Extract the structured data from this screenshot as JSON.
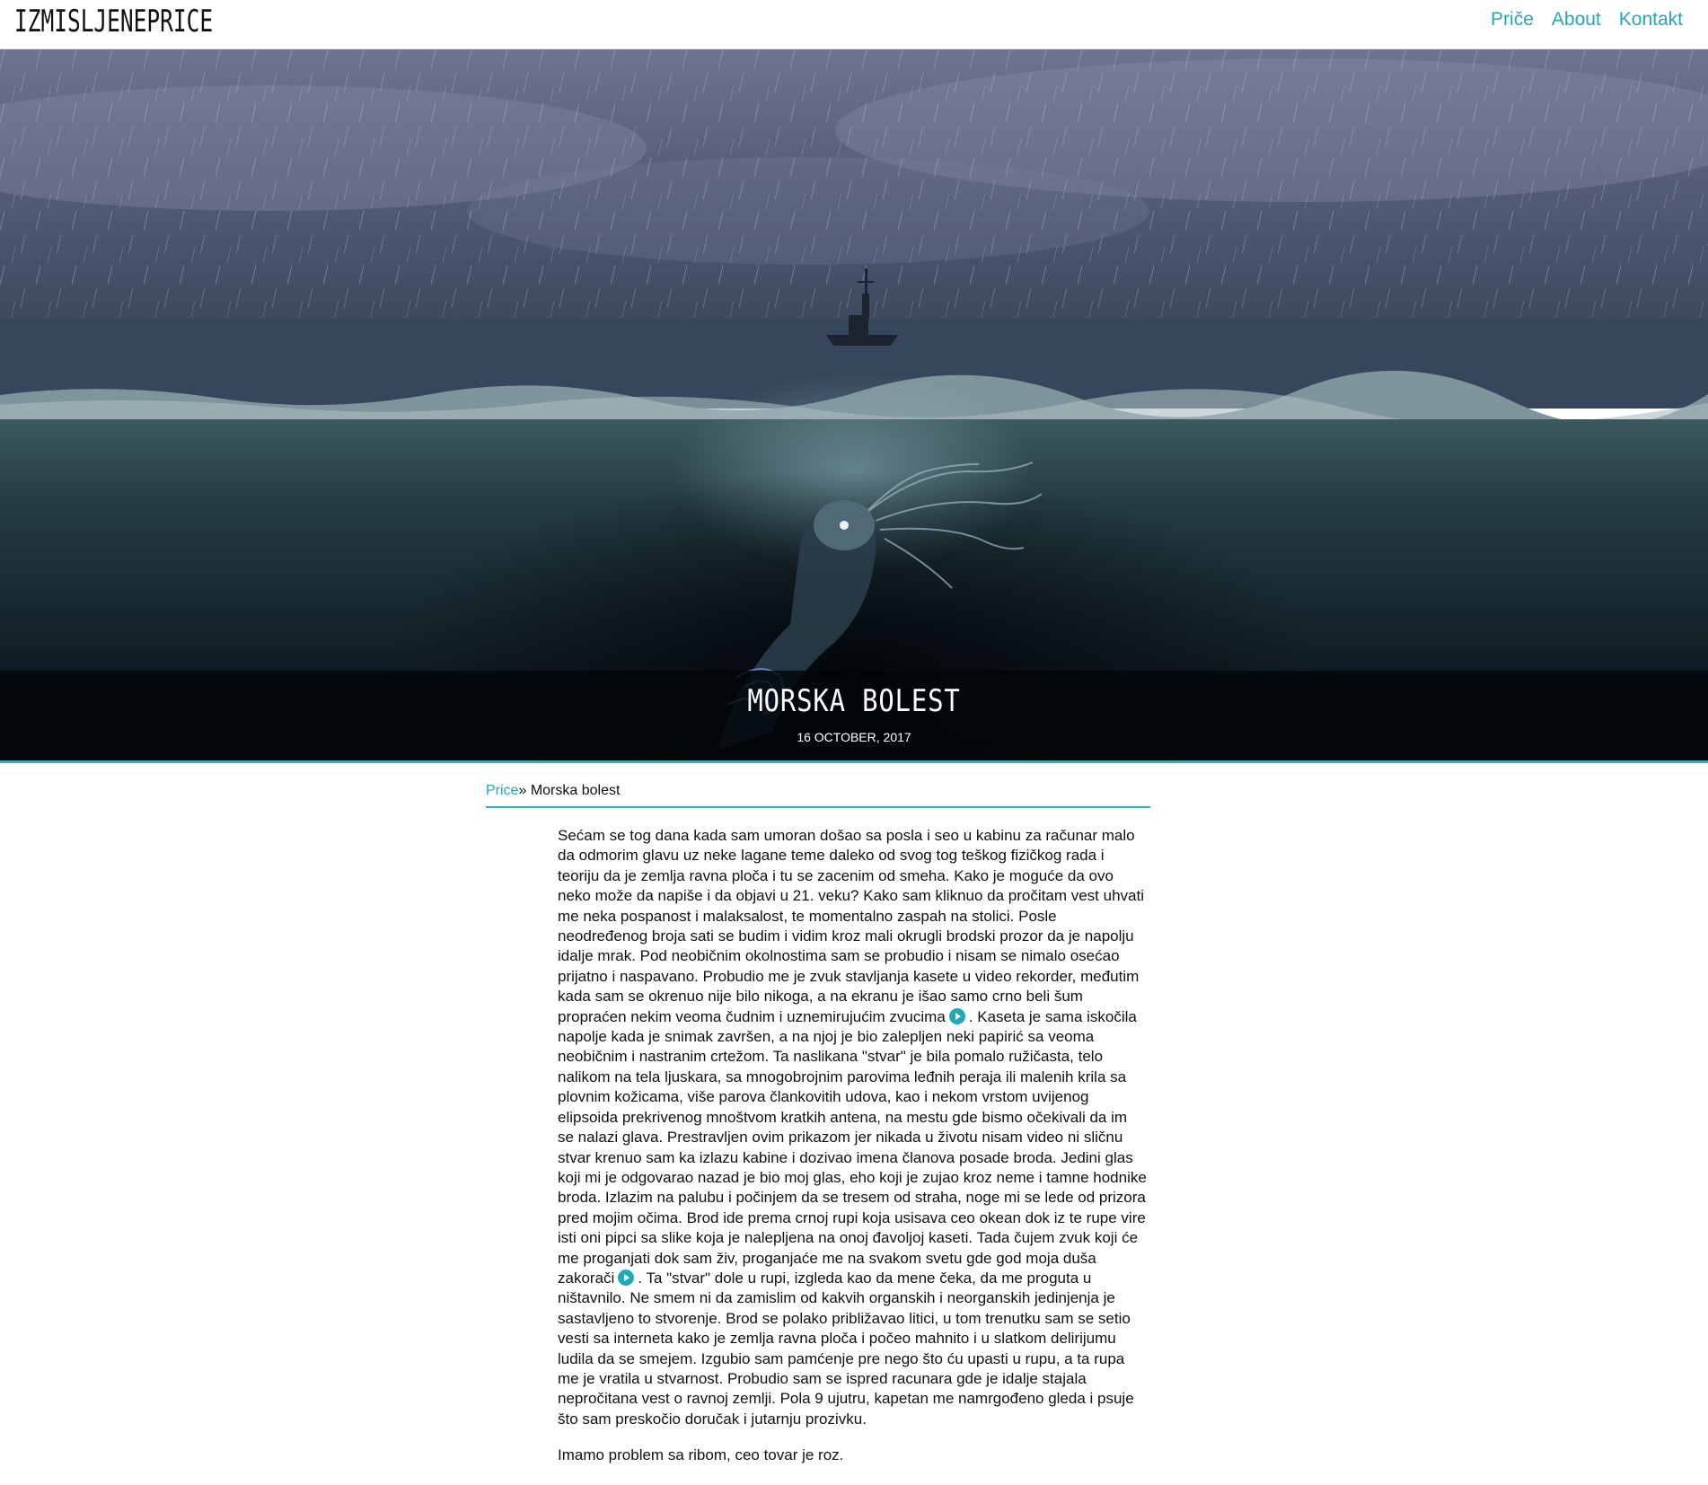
{
  "header": {
    "logo": "IzmisljenePrice",
    "nav": [
      "Priče",
      "About",
      "Kontakt"
    ],
    "accent_color": "#20a9b7"
  },
  "hero": {
    "title": "Morska bolest",
    "date": "16 October, 2017"
  },
  "breadcrumb": {
    "parent": "Price",
    "separator": "»",
    "current": "Morska bolest"
  },
  "article": {
    "p1_part1": "Sećam se tog dana kada sam umoran došao sa posla i seo u kabinu za računar malo da odmorim glavu uz neke lagane teme daleko od svog tog teškog fizičkog rada i teoriju da je zemlja ravna ploča i tu se zacenim od smeha. Kako je moguće da ovo neko može da napiše i da objavi u 21. veku? Kako sam kliknuo da pročitam vest uhvati me neka pospanost i malaksalost, te momentalno zaspah na stolici. Posle neodređenog broja sati se budim i vidim kroz mali okrugli brodski prozor da je napolju idalje mrak. Pod neobičnim okolnostima sam se probudio i nisam se nimalo osećao prijatno i naspavano. Probudio me je zvuk stavljanja kasete u video rekorder, međutim kada sam se okrenuo nije bilo nikoga, a na ekranu je išao samo crno beli šum propraćen nekim veoma čudnim i uznemirujućim zvucima",
    "p1_part2": ". Kaseta je sama iskočila napolje kada je snimak završen, a na njoj je bio zalepljen neki papirić sa veoma neobičnim i nastranim crtežom. Ta naslikana \"stvar\" je bila pomalo ružičasta, telo nalikom na tela ljuskara, sa mnogobrojnim parovima leđnih peraja ili malenih krila sa plovnim kožicama, više parova člankovitih udova, kao i nekom vrstom uvijenog elipsoida prekrivenog mnoštvom kratkih antena, na mestu gde bismo očekivali da im se nalazi glava. Prestravljen ovim prikazom jer nikada u životu nisam video ni sličnu stvar krenuo sam ka izlazu kabine i dozivao imena članova posade broda. Jedini glas koji mi je odgovarao nazad je bio moj glas, eho koji je zujao kroz neme i tamne hodnike broda. Izlazim na palubu i počinjem da se tresem od straha, noge mi se lede od prizora pred mojim očima. Brod ide prema crnoj rupi koja usisava ceo okean dok iz te rupe vire isti oni pipci sa slike koja je nalepljena na onoj đavoljoj kaseti. Tada čujem zvuk koji će me proganjati dok sam živ, proganjaće me na svakom svetu gde god moja duša zakorači",
    "p1_part3": ". Ta \"stvar\" dole u rupi, izgleda kao da mene čeka, da me proguta u ništavnilo. Ne smem ni da zamislim od kakvih organskih i neorganskih jedinjenja je sastavljeno to stvorenje. Brod se polako približavao litici, u tom trenutku sam se setio vesti sa interneta kako je zemlja ravna ploča i počeo mahnito i u slatkom delirijumu ludila da se smejem. Izgubio sam pamćenje pre nego što ću upasti u rupu, a ta rupa me je vratila u stvarnost. Probudio sam se ispred racunara gde je idalje stajala nepročitana vest o ravnoj zemlji. Pola 9 ujutru, kapetan me namrgođeno gleda i psuje što sam preskočio doručak i jutarnju prozivku.",
    "p2": "Imamo problem sa ribom, ceo tovar je roz."
  }
}
